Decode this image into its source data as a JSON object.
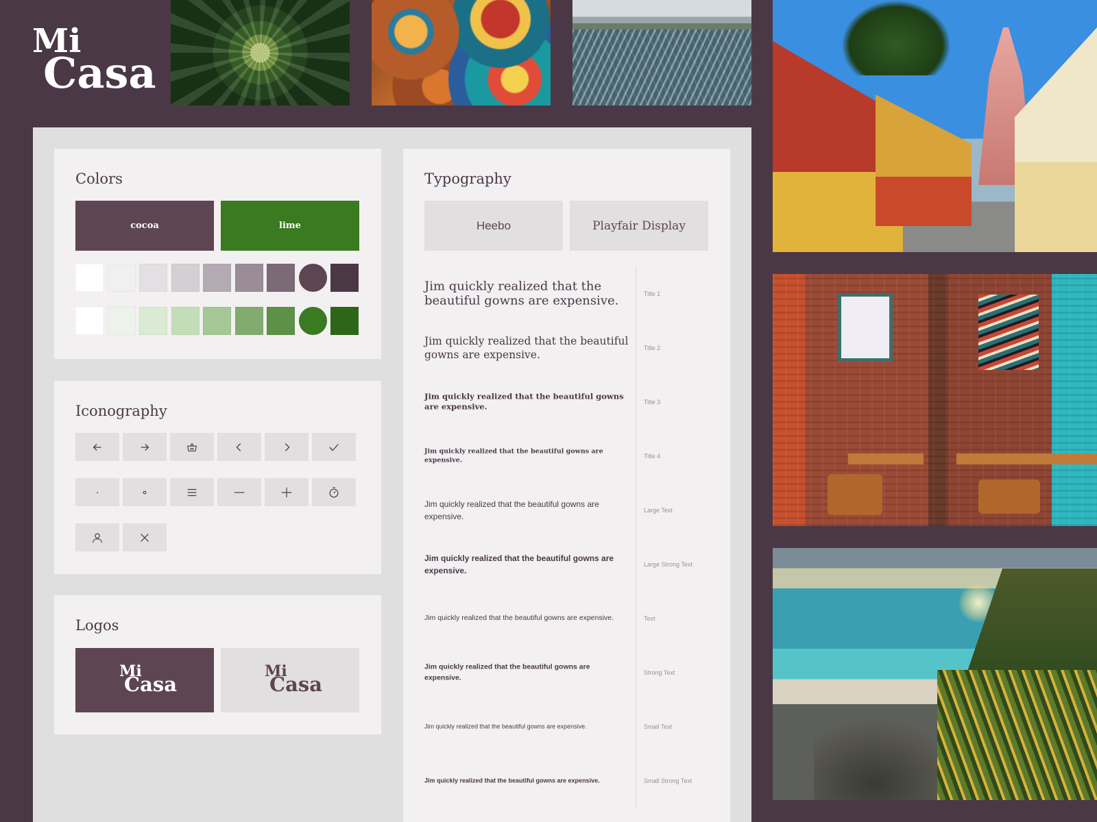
{
  "brand": {
    "line1": "Mi",
    "line2": "Casa"
  },
  "sections": {
    "colors": "Colors",
    "iconography": "Iconography",
    "logos": "Logos",
    "typography": "Typography"
  },
  "colors": {
    "primary": [
      {
        "name": "cocoa",
        "hex": "#5d4552"
      },
      {
        "name": "lime",
        "hex": "#3a7a20"
      }
    ],
    "cocoa_scale": [
      "#ffffff",
      "#f1f0f1",
      "#e2e0e2",
      "#d3cfd2",
      "#b4aab2",
      "#9a8d97",
      "#7b6a77",
      "#5d4552",
      "#4a3846"
    ],
    "lime_scale": [
      "#ffffff",
      "#edf3ea",
      "#daead3",
      "#c4ddb9",
      "#a4c795",
      "#82ac6f",
      "#5d9147",
      "#3a7a20",
      "#2d6619"
    ]
  },
  "icons": [
    "arrow-left",
    "arrow-right",
    "basket",
    "chevron-left",
    "chevron-right",
    "check",
    "dot-small",
    "dot-ring",
    "menu",
    "minus",
    "plus",
    "timer",
    "user",
    "close"
  ],
  "logos": [
    {
      "variant": "dark",
      "line1": "Mi",
      "line2": "Casa"
    },
    {
      "variant": "light",
      "line1": "Mi",
      "line2": "Casa"
    }
  ],
  "typography": {
    "fonts": [
      "Heebo",
      "Playfair Display"
    ],
    "samples": [
      {
        "text": "Jim quickly realized that the beautiful gowns are expensive.",
        "label": "Title 1"
      },
      {
        "text": "Jim quickly realized that the beautiful gowns are expensive.",
        "label": "Title 2"
      },
      {
        "text": "Jim quickly realized that the beautiful gowns are expensive.",
        "label": "Title 3"
      },
      {
        "text": "Jim quickly realized that the beautiful gowns are expensive.",
        "label": "Title 4"
      },
      {
        "text": "Jim quickly realized that the beautiful gowns are expensive.",
        "label": "Large Text"
      },
      {
        "text": "Jim quickly realized that the beautiful gowns are expensive.",
        "label": "Large Strong Text"
      },
      {
        "text": "Jim quickly realized that the beautiful gowns are expensive.",
        "label": "Text"
      },
      {
        "text": "Jim quickly realized that the beautiful gowns are expensive.",
        "label": "Strong Text"
      },
      {
        "text": "Jim quickly realized that the beautiful gowns are expensive.",
        "label": "Small Text"
      },
      {
        "text": "Jim quickly realized that the beautiful gowns are expensive.",
        "label": "Small Strong Text"
      }
    ]
  }
}
